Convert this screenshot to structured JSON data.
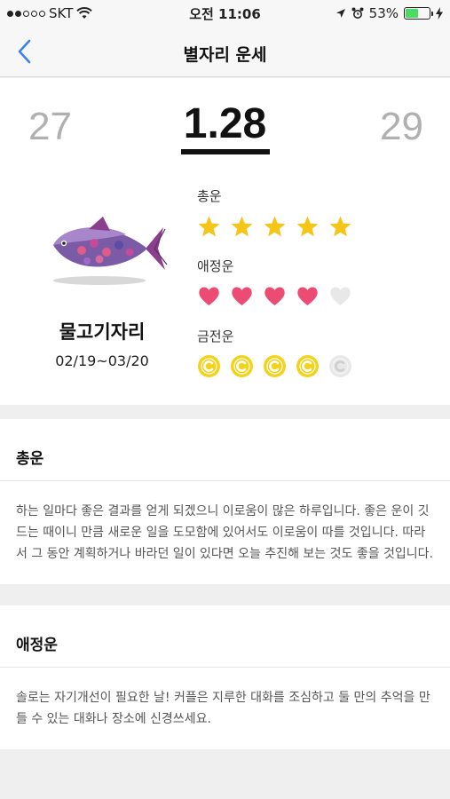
{
  "status_bar": {
    "carrier": "SKT",
    "time": "오전 11:06",
    "battery": "53%",
    "battery_level": 0.53
  },
  "nav": {
    "title": "별자리 운세"
  },
  "date": {
    "prev": "27",
    "current": "1.28",
    "next": "29"
  },
  "zodiac": {
    "name": "물고기자리",
    "range": "02/19~03/20"
  },
  "ratings": [
    {
      "label": "총운",
      "icon": "star-icon",
      "score": 5,
      "max": 5,
      "color": "#f5c518"
    },
    {
      "label": "애정운",
      "icon": "heart-icon",
      "score": 4,
      "max": 5,
      "color": "#ec4c74"
    },
    {
      "label": "금전운",
      "icon": "coin-icon",
      "score": 4,
      "max": 5,
      "color": "#f5d21a"
    }
  ],
  "sections": [
    {
      "title": "총운",
      "body": "하는 일마다 좋은 결과를 얻게 되겠으니 이로움이 많은 하루입니다. 좋은 운이 깃드는 때이니 만큼 새로운 일을 도모함에 있어서도 이로움이 따를 것입니다. 따라서 그 동안 계획하거나 바라던 일이 있다면 오늘 추진해 보는 것도 좋을 것입니다."
    },
    {
      "title": "애정운",
      "body": "솔로는 자기개선이 필요한 날! 커플은 지루한 대화를 조심하고 둘 만의 추억을 만들 수 있는 대화나 장소에 신경쓰세요."
    }
  ],
  "colors": {
    "accent": "#3b82f6",
    "star": "#f5c518",
    "heart": "#ec4c74",
    "coin": "#f5d21a",
    "inactive": "#e8e8e8"
  }
}
